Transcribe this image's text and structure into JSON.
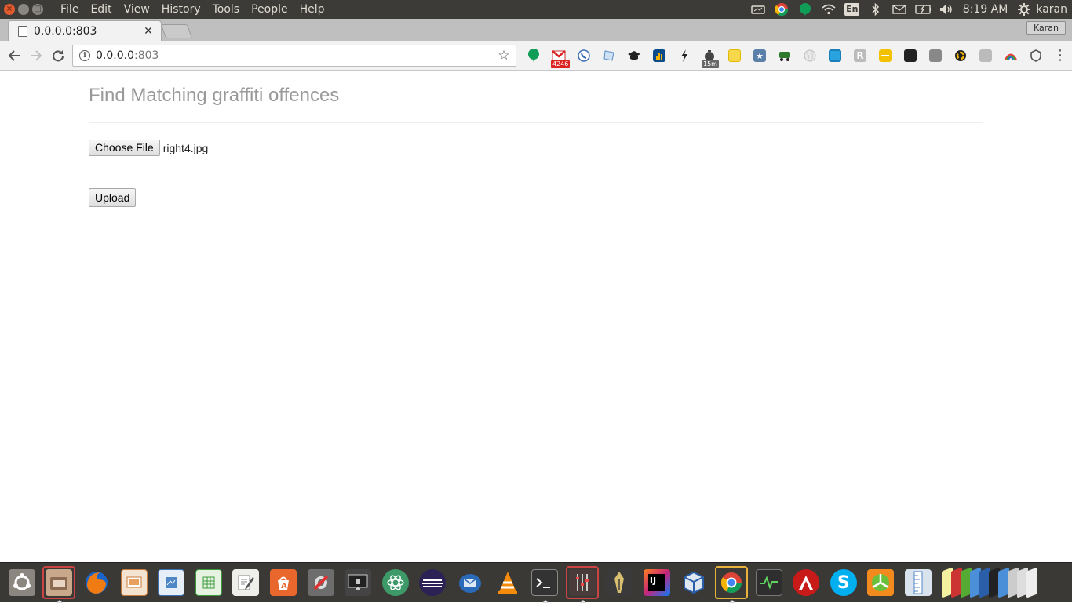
{
  "top_panel": {
    "menu": [
      "File",
      "Edit",
      "View",
      "History",
      "Tools",
      "People",
      "Help"
    ],
    "keyboard": "En",
    "clock": "8:19 AM",
    "user": "karan"
  },
  "browser": {
    "tab_title": "0.0.0.0:803",
    "profile": "Karan",
    "url_host": "0.0.0.0",
    "url_port": ":803",
    "extension_badges": {
      "gmail": "4246",
      "timer": "15m"
    }
  },
  "page": {
    "title": "Find Matching graffiti offences",
    "choose_file_label": "Choose File",
    "chosen_file": "right4.jpg",
    "upload_label": "Upload"
  },
  "colors": {
    "panel": "#3c3b37",
    "launcher": "#3a3936",
    "title_text": "#999999",
    "close_button": "#e05b30"
  }
}
